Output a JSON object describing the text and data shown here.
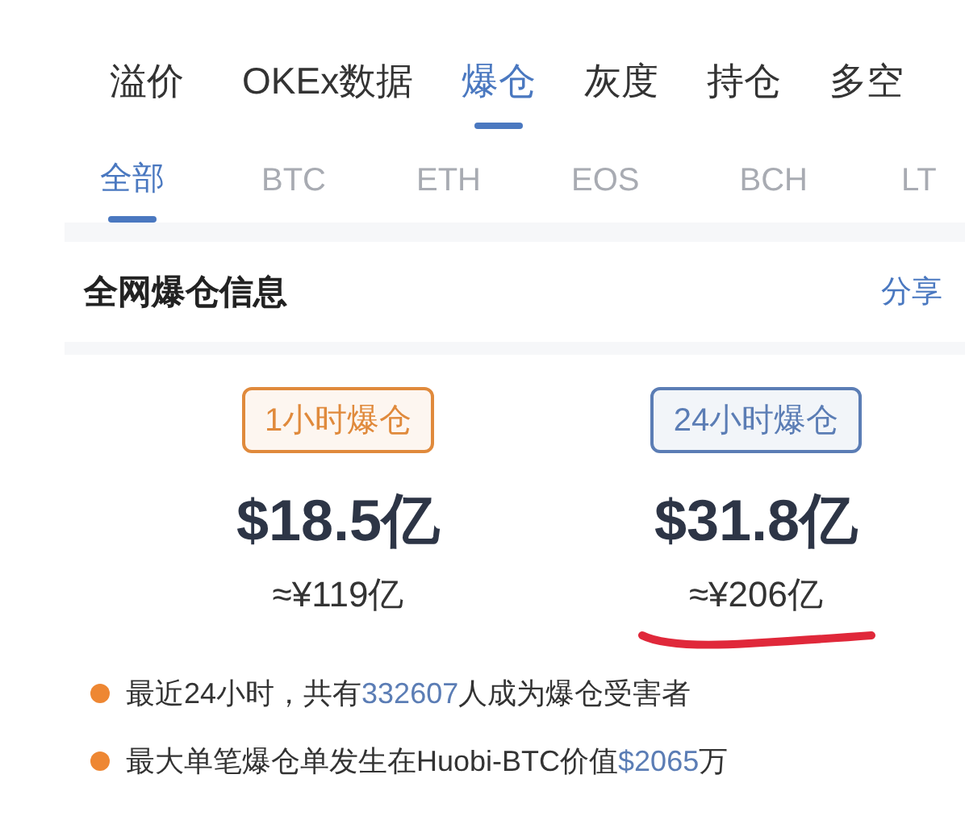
{
  "main_tabs": [
    {
      "label": "溢价",
      "selected": false
    },
    {
      "label": "OKEx数据",
      "selected": false
    },
    {
      "label": "爆仓",
      "selected": true
    },
    {
      "label": "灰度",
      "selected": false
    },
    {
      "label": "持仓",
      "selected": false
    },
    {
      "label": "多空",
      "selected": false
    }
  ],
  "coin_tabs": [
    {
      "label": "全部",
      "selected": true
    },
    {
      "label": "BTC",
      "selected": false
    },
    {
      "label": "ETH",
      "selected": false
    },
    {
      "label": "EOS",
      "selected": false
    },
    {
      "label": "BCH",
      "selected": false
    },
    {
      "label": "LT",
      "selected": false
    }
  ],
  "section": {
    "title": "全网爆仓信息",
    "action": "分享"
  },
  "stats": [
    {
      "badge": "1小时爆仓",
      "color": "#e08a3c",
      "value": "$18.5亿",
      "cny": "≈¥119亿",
      "underlined": false
    },
    {
      "badge": "24小时爆仓",
      "color": "#5b7db5",
      "value": "$31.8亿",
      "cny": "≈¥206亿",
      "underlined": true
    }
  ],
  "facts": [
    {
      "parts": [
        {
          "kind": "plain",
          "text": "最近24小时，共有"
        },
        {
          "kind": "number",
          "text": "332607"
        },
        {
          "kind": "plain",
          "text": "人成为爆仓受害者"
        }
      ]
    },
    {
      "parts": [
        {
          "kind": "plain",
          "text": "最大单笔爆仓单发生在Huobi-BTC价值"
        },
        {
          "kind": "number",
          "text": "$2065"
        },
        {
          "kind": "plain",
          "text": "万"
        }
      ]
    }
  ]
}
